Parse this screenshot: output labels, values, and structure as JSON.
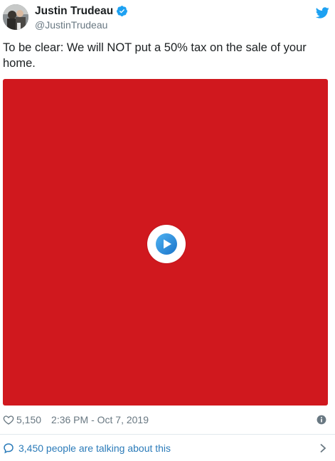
{
  "author": {
    "display_name": "Justin Trudeau",
    "handle": "@JustinTrudeau",
    "verified_icon": "verified-badge-icon"
  },
  "tweet": {
    "text": "To be clear: We will NOT put a 50% tax on the sale of your home."
  },
  "media": {
    "background_color": "#d0181e",
    "play_icon": "play-icon"
  },
  "stats": {
    "likes": "5,150",
    "timestamp": "2:36 PM - Oct 7, 2019"
  },
  "conversation": {
    "label": "3,450 people are talking about this"
  },
  "colors": {
    "twitter_blue": "#1da1f2",
    "link_blue": "#2b7bb9",
    "muted_gray": "#697882"
  }
}
